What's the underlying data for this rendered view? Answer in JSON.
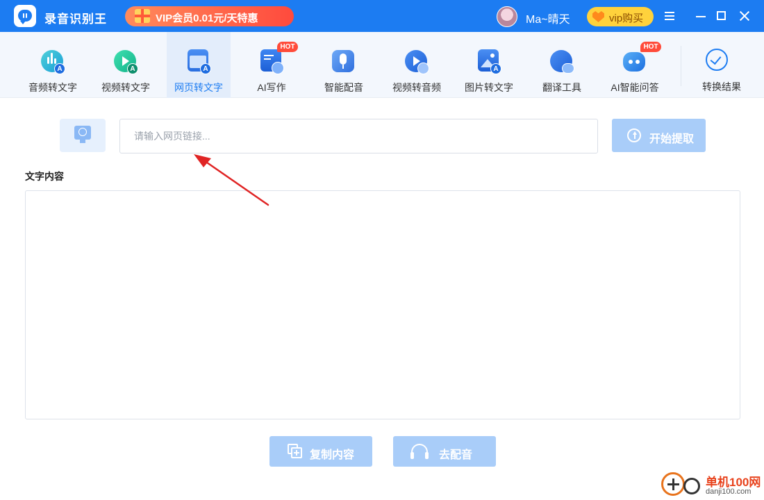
{
  "app": {
    "title": "录音识别王",
    "vip_banner": "VIP会员0.01元/天特惠",
    "username": "Ma~晴天",
    "vip_buy_label": "vip购买"
  },
  "toolbar": {
    "items": [
      {
        "label": "音频转文字",
        "icon": "audio-to-text-icon",
        "active": false
      },
      {
        "label": "视频转文字",
        "icon": "video-to-text-icon",
        "active": false
      },
      {
        "label": "网页转文字",
        "icon": "webpage-to-text-icon",
        "active": true
      },
      {
        "label": "AI写作",
        "icon": "ai-writing-icon",
        "active": false,
        "badge": "HOT"
      },
      {
        "label": "智能配音",
        "icon": "smart-dubbing-icon",
        "active": false
      },
      {
        "label": "视频转音频",
        "icon": "video-to-audio-icon",
        "active": false
      },
      {
        "label": "图片转文字",
        "icon": "image-to-text-icon",
        "active": false
      },
      {
        "label": "翻译工具",
        "icon": "translate-icon",
        "active": false
      },
      {
        "label": "AI智能问答",
        "icon": "ai-qa-icon",
        "active": false,
        "badge": "HOT"
      }
    ],
    "result_label": "转换结果"
  },
  "url_input": {
    "placeholder": "请输入网页链接...",
    "value": ""
  },
  "extract_button": "开始提取",
  "content_section": {
    "label": "文字内容",
    "text": ""
  },
  "actions": {
    "copy_label": "复制内容",
    "dub_label": "去配音"
  },
  "watermark": {
    "name": "单机100网",
    "url": "danji100.com"
  },
  "colors": {
    "primary": "#1c7cf2",
    "toolbar_bg": "#f3f7fd",
    "active_tab_bg": "#e3edfb",
    "disabled_button": "#a9cdf9",
    "hot_badge": "#ff4b3a",
    "annotation_arrow": "#e02424"
  }
}
